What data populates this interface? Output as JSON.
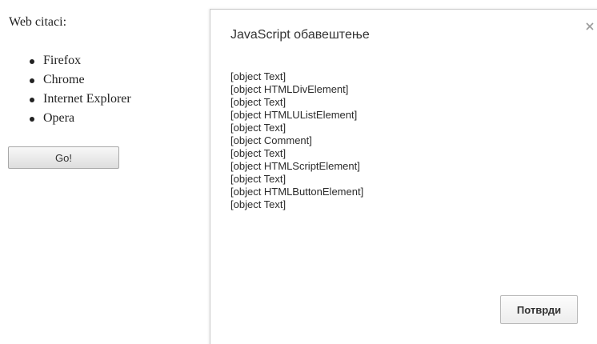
{
  "page": {
    "heading": "Web citaci:",
    "browsers": [
      {
        "label": "Firefox"
      },
      {
        "label": "Chrome"
      },
      {
        "label": "Internet Explorer"
      },
      {
        "label": "Opera"
      }
    ],
    "go_button_label": "Go!"
  },
  "dialog": {
    "title": "JavaScript обавештење",
    "close_icon": "close-icon",
    "message_lines": [
      "[object Text]",
      "[object HTMLDivElement]",
      "[object Text]",
      "[object HTMLUListElement]",
      "[object Text]",
      "[object Comment]",
      "[object Text]",
      "[object HTMLScriptElement]",
      "[object Text]",
      "[object HTMLButtonElement]",
      "[object Text]"
    ],
    "confirm_label": "Потврди"
  },
  "colors": {
    "text": "#222222",
    "dialog_border": "#c8c8c8",
    "button_border": "#a8a8a8"
  }
}
